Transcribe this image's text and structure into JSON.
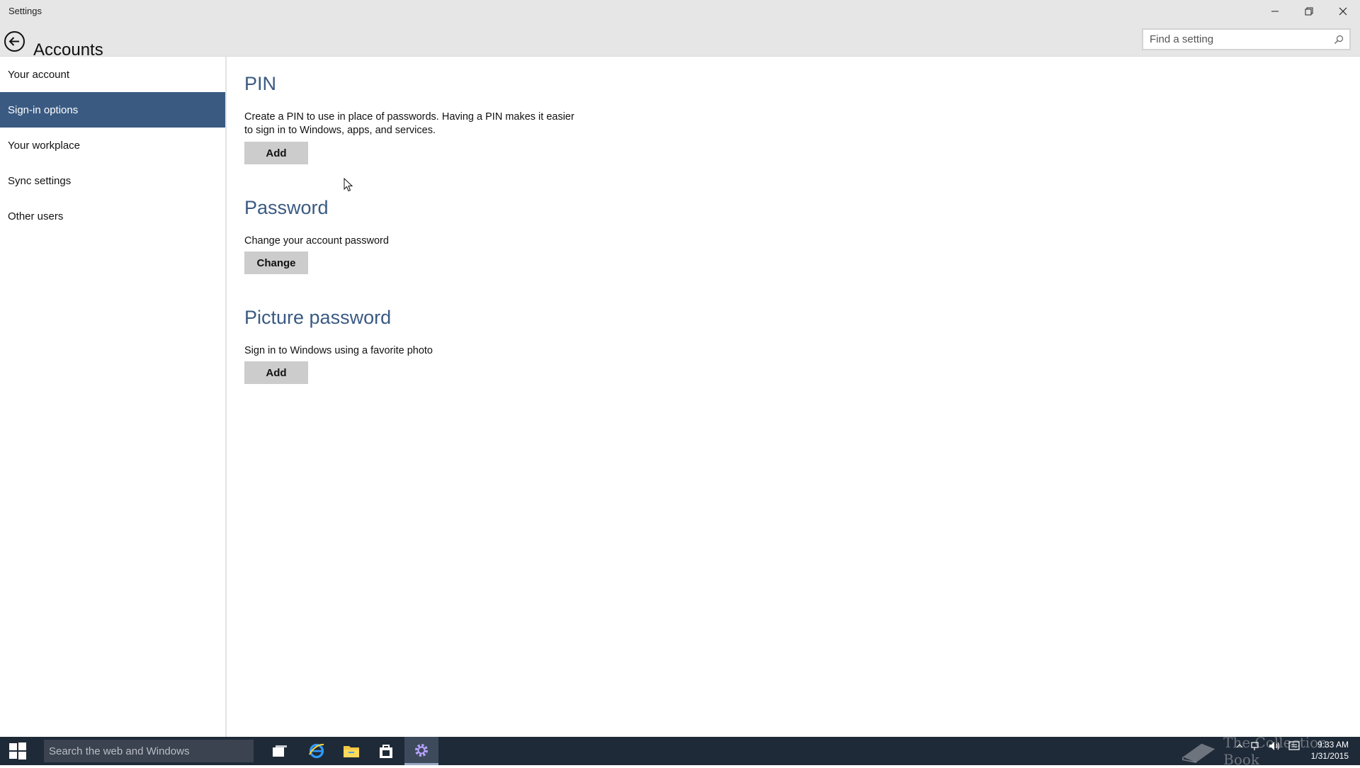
{
  "window": {
    "title": "Settings",
    "controls": [
      "minimize-icon",
      "restore-icon",
      "close-icon"
    ]
  },
  "header": {
    "page_title": "Accounts",
    "search_placeholder": "Find a setting"
  },
  "sidebar": {
    "selected_index": 1,
    "items": [
      {
        "label": "Your account"
      },
      {
        "label": "Sign-in options"
      },
      {
        "label": "Your workplace"
      },
      {
        "label": "Sync settings"
      },
      {
        "label": "Other users"
      }
    ]
  },
  "sections": [
    {
      "heading": "PIN",
      "description": "Create a PIN to use in place of passwords. Having a PIN makes it easier to sign in to Windows, apps, and services.",
      "button": "Add"
    },
    {
      "heading": "Password",
      "description": "Change your account password",
      "button": "Change"
    },
    {
      "heading": "Picture password",
      "description": "Sign in to Windows using a favorite photo",
      "button": "Add"
    }
  ],
  "taskbar": {
    "search_placeholder": "Search the web and Windows",
    "watermark": "The Collection Book",
    "time": "9:33 AM",
    "date": "1/31/2015"
  },
  "colors": {
    "accent": "#3a5a82",
    "chrome": "#e6e6e6",
    "button": "#cccccc",
    "taskbar": "#1f2a38"
  }
}
